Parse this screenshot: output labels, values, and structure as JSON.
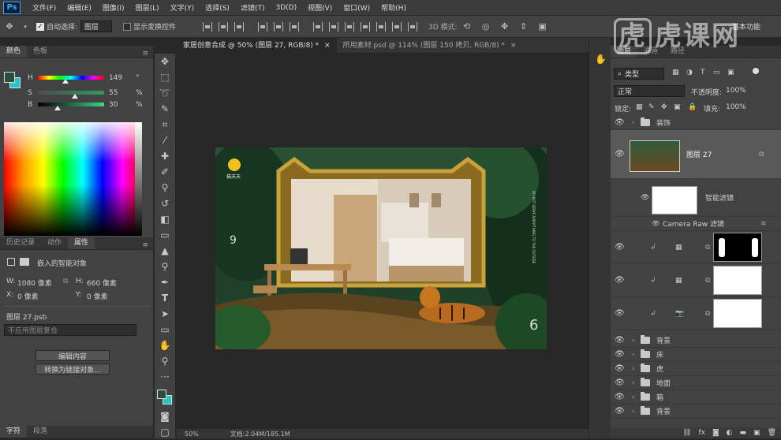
{
  "app": {
    "logo": "Ps"
  },
  "menu": [
    "文件(F)",
    "编辑(E)",
    "图像(I)",
    "图层(L)",
    "文字(Y)",
    "选择(S)",
    "滤镜(T)",
    "3D(D)",
    "视图(V)",
    "窗口(W)",
    "帮助(H)"
  ],
  "options": {
    "auto_select_label": "自动选择:",
    "auto_select_value": "图层",
    "show_transform_label": "显示变换控件",
    "mode_3d": "3D 模式:",
    "workspace": "基本功能"
  },
  "watermark": "虎课网",
  "color_panel": {
    "tabs": [
      "颜色",
      "色板"
    ],
    "h": {
      "label": "H",
      "value": "149",
      "unit": "°"
    },
    "s": {
      "label": "S",
      "value": "55",
      "unit": "%"
    },
    "b": {
      "label": "B",
      "value": "30",
      "unit": "%"
    },
    "fg_color": "#2d4d3c",
    "bg_color": "#25c6c4"
  },
  "props_panel": {
    "tabs": [
      "历史记录",
      "动作",
      "属性"
    ],
    "type": "嵌入的智能对象",
    "w_label": "W:",
    "w_value": "1080 像素",
    "h_label": "H:",
    "h_value": "660 像素",
    "x_label": "X:",
    "x_value": "0 像素",
    "y_label": "Y:",
    "y_value": "0 像素",
    "file": "图层 27.psb",
    "comp": "不应用图层复合",
    "btn_edit": "编辑内容",
    "btn_convert": "转换为链接对象..."
  },
  "bottom_tabs": [
    "字符",
    "段落"
  ],
  "doc_tabs": [
    {
      "label": "家居创意合成 @ 50% (图层 27, RGB/8) *",
      "close": "×"
    },
    {
      "label": "所用素材.psd @ 114% (图层 150 拷贝, RGB/8) *",
      "close": "×"
    }
  ],
  "status": {
    "zoom": "50%",
    "doc": "文档:2.04M/185.1M"
  },
  "canvas_art": {
    "brand": "猫天天",
    "num_left": "9",
    "num_right": "6",
    "vertical_text": "DO NOT SERVE EVERYTHING TO THE OUTSIDE"
  },
  "layers_panel": {
    "tabs": [
      "图层",
      "通道",
      "路径"
    ],
    "kind": "类型",
    "blend": "正常",
    "opacity_label": "不透明度:",
    "opacity": "100%",
    "lock_label": "锁定:",
    "fill_label": "填充:",
    "fill": "100%",
    "rows": [
      {
        "name": "装饰",
        "type": "group"
      },
      {
        "name": "图层 27",
        "type": "smart"
      },
      {
        "name": "智能滤镜",
        "type": "filter"
      },
      {
        "name": "Camera Raw 滤镜",
        "type": "filter-item"
      },
      {
        "name": "",
        "type": "adj-mask-black"
      },
      {
        "name": "",
        "type": "adj-mask-white"
      },
      {
        "name": "",
        "type": "adj-mask-white2"
      },
      {
        "name": "背景",
        "type": "group"
      },
      {
        "name": "床",
        "type": "group"
      },
      {
        "name": "虎",
        "type": "group"
      },
      {
        "name": "地面",
        "type": "group"
      },
      {
        "name": "箱",
        "type": "group"
      },
      {
        "name": "背景",
        "type": "group"
      }
    ]
  },
  "colors": {
    "accent": "#31a8ff",
    "panel": "#424242",
    "dark": "#282828"
  }
}
